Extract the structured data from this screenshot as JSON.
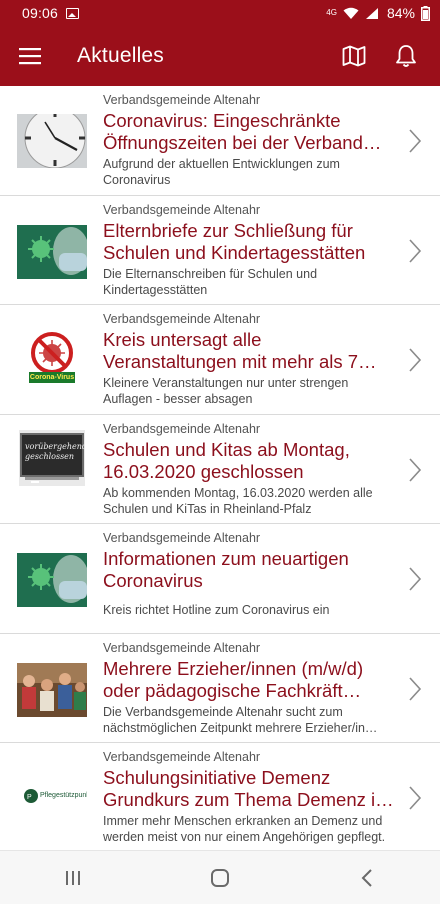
{
  "status_bar": {
    "time": "09:06",
    "network": "4G",
    "battery": "84%",
    "icons": [
      "gallery-icon",
      "wifi-icon",
      "signal-icon",
      "battery-icon"
    ]
  },
  "app_bar": {
    "title": "Aktuelles",
    "background_color": "#9b0f1a",
    "icons": [
      "menu-icon",
      "map-icon",
      "bell-icon"
    ]
  },
  "news": [
    {
      "source": "Verbandsgemeinde Altenahr",
      "title": "Coronavirus: Eingeschränkte Öffnungszeiten bei der Verband…",
      "teaser": "Aufgrund der aktuellen Entwicklungen zum Coronavirus",
      "thumb": "clock-thumbnail"
    },
    {
      "source": "Verbandsgemeinde Altenahr",
      "title": "Elternbriefe zur Schließung für Schulen und Kindertagesstätten",
      "teaser": "Die Elternanschreiben für Schulen und Kindertagesstätten",
      "thumb": "virus-mask-thumbnail"
    },
    {
      "source": "Verbandsgemeinde Altenahr",
      "title": "Kreis untersagt alle Veranstaltungen mit mehr als 7…",
      "teaser": "Kleinere Veranstaltungen nur unter strengen Auflagen - besser absagen",
      "thumb": "corona-virus-sign-thumbnail",
      "thumb_label": "Corona-Virus"
    },
    {
      "source": "Verbandsgemeinde Altenahr",
      "title": "Schulen und Kitas ab Montag, 16.03.2020 geschlossen",
      "teaser": "Ab kommenden Montag, 16.03.2020 werden alle Schulen und KiTas in Rheinland-Pfalz",
      "thumb": "chalkboard-thumbnail",
      "thumb_label": "vorübergehend geschlossen"
    },
    {
      "source": "Verbandsgemeinde Altenahr",
      "title": "Informationen zum neuartigen Coronavirus",
      "teaser": "Kreis richtet Hotline zum Coronavirus ein",
      "thumb": "virus-mask-thumbnail"
    },
    {
      "source": "Verbandsgemeinde Altenahr",
      "title": "Mehrere Erzieher/innen (m/w/d) oder pädagogische Fachkräft…",
      "teaser": "Die Verbandsgemeinde Altenahr sucht zum nächstmöglichen Zeitpunkt mehrere Erzieher/in…",
      "thumb": "children-group-thumbnail"
    },
    {
      "source": "Verbandsgemeinde Altenahr",
      "title": "Schulungsinitiative Demenz Grundkurs zum Thema Demenz i…",
      "teaser": "Immer mehr Menschen erkranken an Demenz und werden meist von nur einem Angehörigen gepflegt.",
      "thumb": "logo-thumbnail",
      "thumb_label": "Pflegestützpunkt"
    }
  ],
  "colors": {
    "accent": "#9b0f1a",
    "headline": "#8c0f1c"
  },
  "nav_bar": {
    "icons": [
      "recent-apps-icon",
      "home-icon",
      "back-icon"
    ]
  }
}
